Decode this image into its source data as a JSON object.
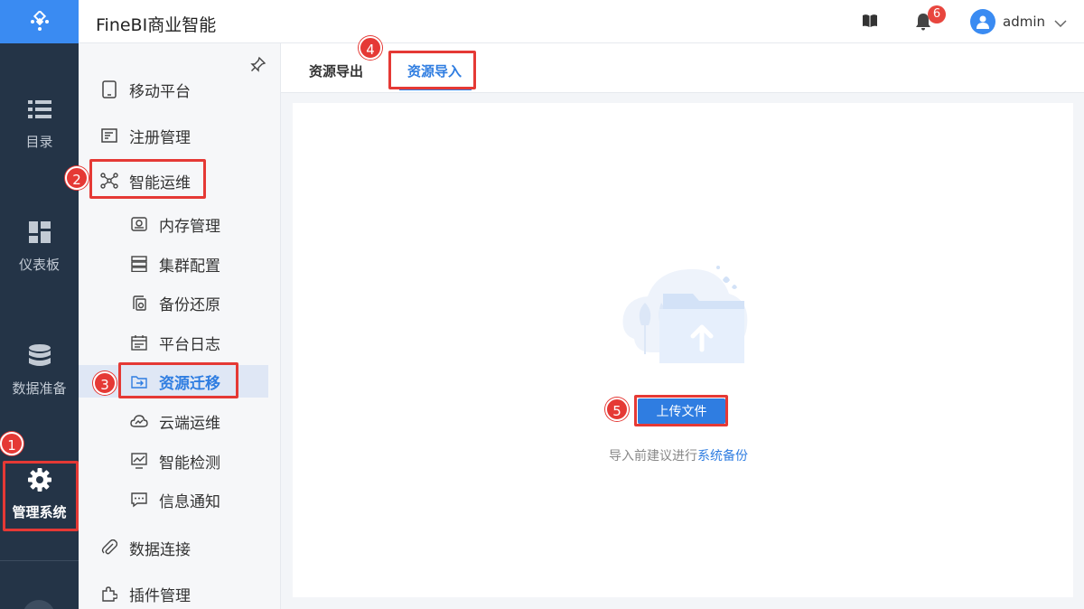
{
  "app": {
    "title": "FineBI商业智能"
  },
  "rail": {
    "items": [
      {
        "label": "目录",
        "icon": "list-icon"
      },
      {
        "label": "仪表板",
        "icon": "dashboard-icon"
      },
      {
        "label": "数据准备",
        "icon": "database-icon"
      },
      {
        "label": "管理系统",
        "icon": "gear-icon",
        "active": true
      }
    ]
  },
  "topbar": {
    "help_icon": "book-icon",
    "notification_icon": "bell-icon",
    "notification_count": "6",
    "user_name": "admin"
  },
  "menu": {
    "items": [
      {
        "label": "移动平台",
        "icon": "tablet-icon"
      },
      {
        "label": "注册管理",
        "icon": "register-icon"
      },
      {
        "label": "智能运维",
        "icon": "network-icon"
      },
      {
        "label": "内存管理",
        "icon": "memory-icon"
      },
      {
        "label": "集群配置",
        "icon": "server-icon"
      },
      {
        "label": "备份还原",
        "icon": "backup-icon"
      },
      {
        "label": "平台日志",
        "icon": "log-icon"
      },
      {
        "label": "资源迁移",
        "icon": "folder-arrow-icon",
        "selected": true
      },
      {
        "label": "云端运维",
        "icon": "cloud-icon"
      },
      {
        "label": "智能检测",
        "icon": "monitor-icon"
      },
      {
        "label": "信息通知",
        "icon": "message-icon"
      },
      {
        "label": "数据连接",
        "icon": "paperclip-icon"
      },
      {
        "label": "插件管理",
        "icon": "puzzle-icon"
      }
    ]
  },
  "tabs": [
    {
      "label": "资源导出"
    },
    {
      "label": "资源导入",
      "active": true
    }
  ],
  "content": {
    "upload_label": "上传文件",
    "hint_prefix": "导入前建议进行",
    "hint_link": "系统备份"
  },
  "annotations": [
    "1",
    "2",
    "3",
    "4",
    "5"
  ],
  "colors": {
    "accent": "#2f7de1",
    "rail": "#243447",
    "annotation": "#e53935"
  }
}
